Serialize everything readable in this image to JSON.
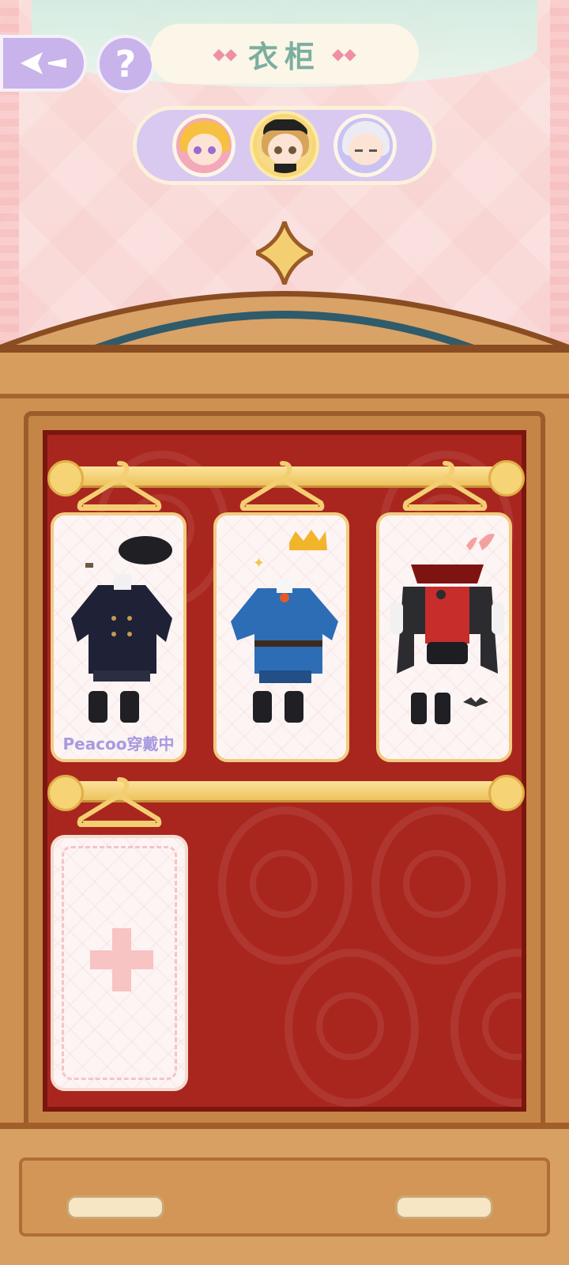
{
  "header": {
    "title": "衣柜",
    "help_label": "?"
  },
  "characters": [
    {
      "name": "avatar-blonde-girl",
      "selected": false
    },
    {
      "name": "avatar-beret-boy",
      "selected": true
    },
    {
      "name": "avatar-silver-girl",
      "selected": false
    }
  ],
  "outfits": [
    {
      "name": "outfit-black-beret-suit",
      "status_label": "Peacoo穿戴中"
    },
    {
      "name": "outfit-blue-prince-uniform",
      "status_label": ""
    },
    {
      "name": "outfit-vampire-costume",
      "status_label": ""
    }
  ],
  "add_slot": {
    "icon": "plus-icon"
  },
  "colors": {
    "accent": "#c8b3ea",
    "title": "#7caea0",
    "wood": "#cf9152",
    "velvet": "#a9261f"
  }
}
